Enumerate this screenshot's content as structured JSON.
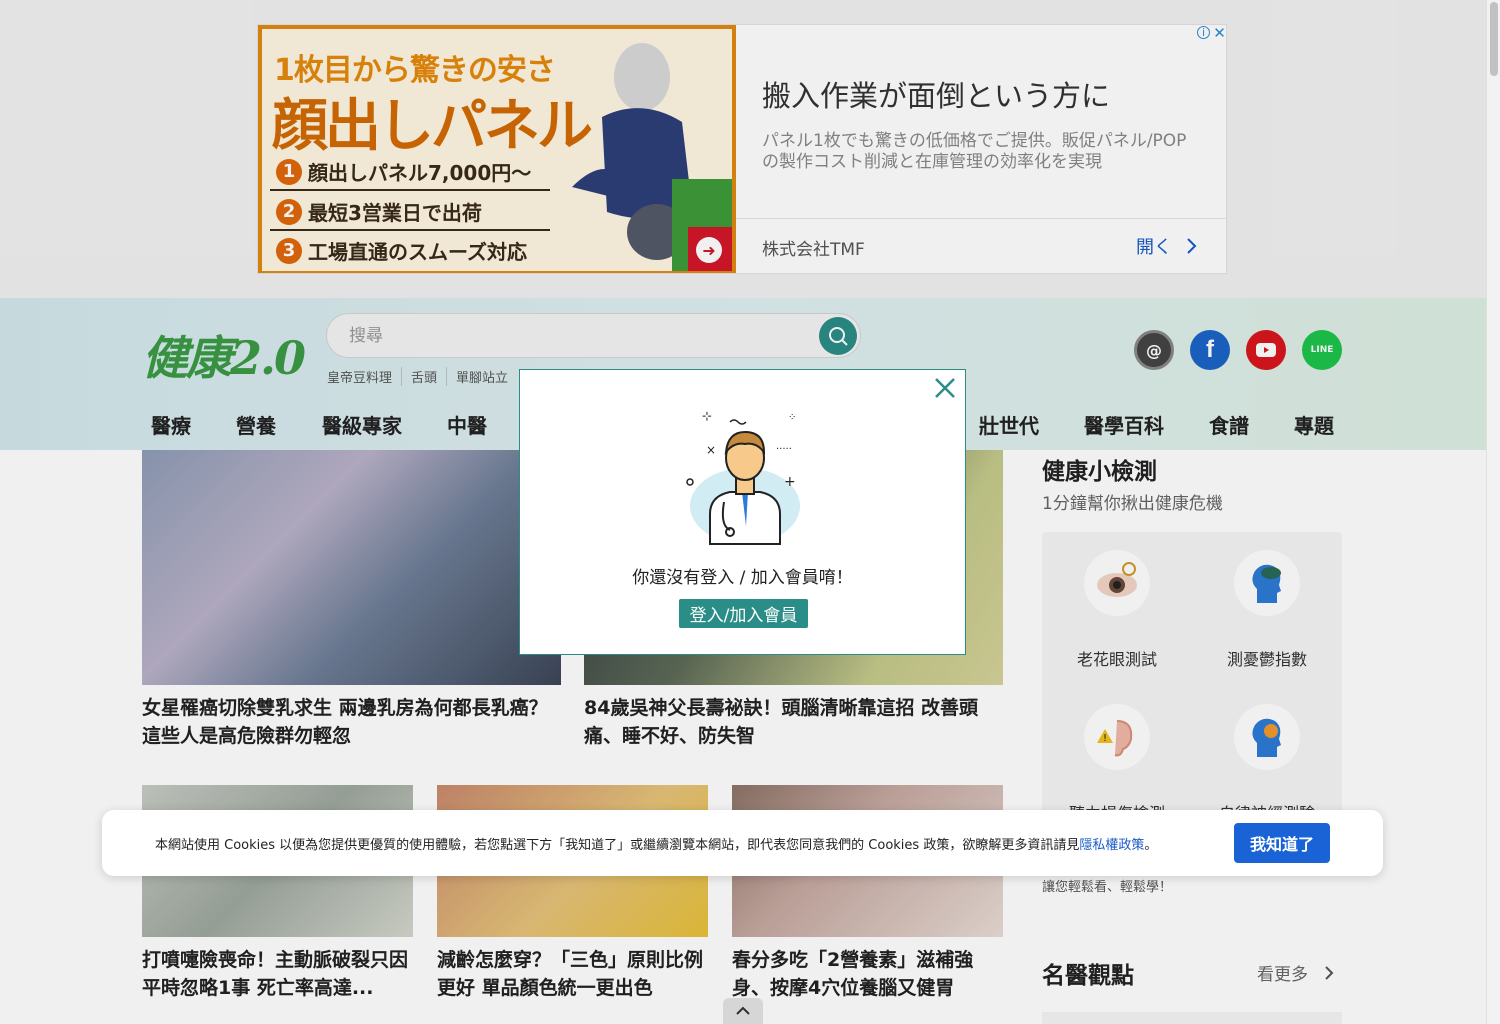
{
  "ad": {
    "image_headline_1": "1枚目から驚きの安さ",
    "image_headline_2": "顔出しパネル",
    "image_points": [
      {
        "num": "1",
        "text": "顔出しパネル7,000円〜"
      },
      {
        "num": "2",
        "text": "最短3営業日で出荷"
      },
      {
        "num": "3",
        "text": "工場直通のスムーズ対応"
      }
    ],
    "headline": "搬入作業が面倒という方に",
    "body": "パネル1枚でも驚きの低価格でご提供。販促パネル/POPの製作コスト削減と在庫管理の効率化を実現",
    "company": "株式会社TMF",
    "open_label": "開く",
    "info_icon": "info-icon",
    "close_icon": "close-icon"
  },
  "header": {
    "logo": "健康2.0",
    "search_placeholder": "搜尋",
    "hot_tags": [
      "皇帝豆料理",
      "舌頭",
      "單腳站立"
    ],
    "socials": [
      "threads-icon",
      "facebook-icon",
      "youtube-icon",
      "line-icon"
    ]
  },
  "nav": [
    "醫療",
    "營養",
    "醫級專家",
    "中醫",
    "壯世代",
    "醫學百科",
    "食譜",
    "專題"
  ],
  "articles": [
    {
      "title": "女星罹癌切除雙乳求生 兩邊乳房為何都長乳癌？這些人是高危險群勿輕忽"
    },
    {
      "title": "84歲吳神父長壽祕訣！頭腦清晰靠這招 改善頭痛、睡不好、防失智"
    },
    {
      "title": "打噴嚏險喪命！主動脈破裂只因平時忽略1事 死亡率高達..."
    },
    {
      "title": "減齡怎麼穿？「三色」原則比例更好 單品顏色統一更出色"
    },
    {
      "title": "春分多吃「2營養素」滋補強身、按摩4穴位養腦又健胃"
    }
  ],
  "sidebar": {
    "quiz_title": "健康小檢測",
    "quiz_subtitle": "1分鐘幫你揪出健康危機",
    "quizzes": [
      {
        "label": "老花眼測試",
        "icon": "eye-icon"
      },
      {
        "label": "測憂鬱指數",
        "icon": "head-cloud-icon"
      },
      {
        "label": "聽力損傷檢測",
        "icon": "ear-warning-icon"
      },
      {
        "label": "自律神經測驗",
        "icon": "head-gear-icon"
      }
    ],
    "note": "讓您輕鬆看、輕鬆學！",
    "doctors_title": "名醫觀點",
    "more_label": "看更多"
  },
  "modal": {
    "message": "你還沒有登入 / 加入會員唷！",
    "button": "登入/加入會員"
  },
  "cookie": {
    "text": "本網站使用 Cookies 以便為您提供更優質的使用體驗，若您點選下方「我知道了」或繼續瀏覽本網站，即代表您同意我們的 Cookies 政策，欲瞭解更多資訊請見",
    "link": "隱私權政策",
    "suffix": "。",
    "button": "我知道了"
  },
  "colors": {
    "brand_green": "#3b9b46",
    "teal": "#2b8d87",
    "cookie_blue": "#1a63d6"
  }
}
